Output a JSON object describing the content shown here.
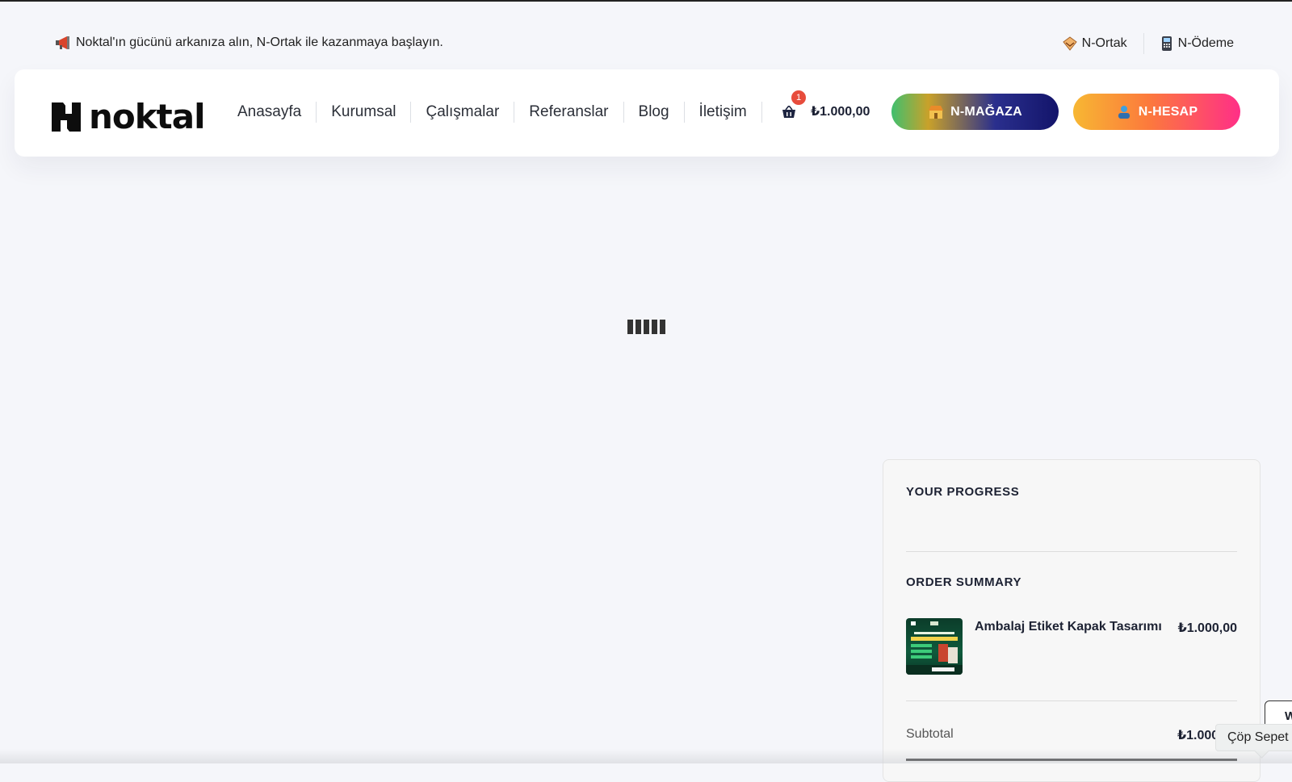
{
  "announcement": {
    "icon": "megaphone-icon",
    "text": "Noktal'ın gücünü arkanıza alın, N-Ortak ile kazanmaya başlayın."
  },
  "top_links": [
    {
      "label": "N-Ortak",
      "icon": "handshake-icon"
    },
    {
      "label": "N-Ödeme",
      "icon": "payment-terminal-icon"
    }
  ],
  "brand": {
    "logo_text": "noktal"
  },
  "nav": {
    "items": [
      "Anasayfa",
      "Kurumsal",
      "Çalışmalar",
      "Referanslar",
      "Blog",
      "İletişim"
    ]
  },
  "cart": {
    "count": "1",
    "total": "₺1.000,00",
    "icon": "basket-icon"
  },
  "buttons": {
    "magaza": {
      "label": "N-MAĞAZA",
      "icon": "store-icon"
    },
    "hesap": {
      "label": "N-HESAP",
      "icon": "user-icon"
    }
  },
  "order_panel": {
    "progress_title": "YOUR PROGRESS",
    "summary_title": "ORDER SUMMARY",
    "item": {
      "name": "Ambalaj Etiket Kapak Tasarımı",
      "price": "₺1.000,00"
    },
    "subtotal_label": "Subtotal",
    "subtotal_value": "₺1.000"
  },
  "overlay": {
    "tooltip": "Çöp Sepet",
    "edge_letter": "W"
  },
  "colors": {
    "background": "#f5f6fa",
    "badge": "#e74c3c",
    "magaza_gradient": [
      "#3fbf6e",
      "#c9a12a",
      "#2a2f8d",
      "#13146a"
    ],
    "hesap_gradient": [
      "#f7b733",
      "#fc7a3c",
      "#ff2f87"
    ]
  }
}
